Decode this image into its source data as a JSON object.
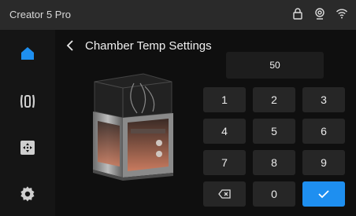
{
  "header": {
    "title": "Creator 5 Pro",
    "status_icons": [
      "lock-icon",
      "camera-icon",
      "wifi-icon"
    ]
  },
  "sidebar": {
    "items": [
      {
        "icon": "home-icon",
        "active": true
      },
      {
        "icon": "extruder-icon",
        "active": false
      },
      {
        "icon": "move-icon",
        "active": false
      },
      {
        "icon": "settings-gear-icon",
        "active": false
      }
    ]
  },
  "page": {
    "title": "Chamber Temp Settings"
  },
  "input": {
    "value": "50"
  },
  "keypad": {
    "keys": [
      "1",
      "2",
      "3",
      "4",
      "5",
      "6",
      "7",
      "8",
      "9",
      "",
      "0",
      ""
    ],
    "backspace_icon": "backspace-icon",
    "confirm_icon": "checkmark-icon"
  },
  "colors": {
    "accent": "#1e8ff0",
    "topbar": "#2a2a2a",
    "sidebar": "#151515",
    "background": "#0f0f0f",
    "key": "#262626"
  }
}
